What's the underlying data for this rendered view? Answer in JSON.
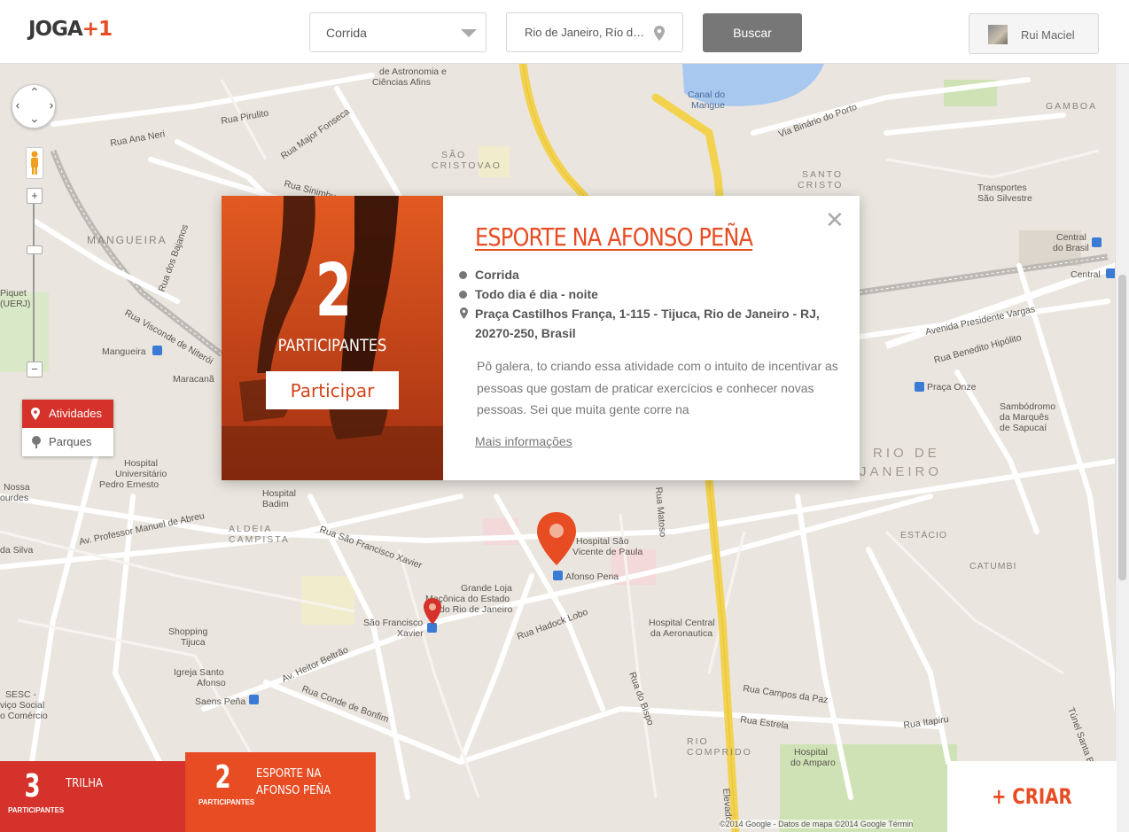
{
  "app": {
    "logo_text": "JOGA",
    "logo_plus": "+1"
  },
  "search": {
    "sport_value": "Corrida",
    "location_value": "Rio de Janeiro, Río de Janeiro, Brasil",
    "button_label": "Buscar"
  },
  "user": {
    "name": "Rui Maciel"
  },
  "layers": {
    "items": [
      {
        "label": "Atividades",
        "active": true
      },
      {
        "label": "Parques",
        "active": false
      }
    ]
  },
  "map_labels": [
    "de Astronomia e",
    "Ciências Afins",
    "Rua Ana Neri",
    "Rua Pirulito",
    "Rua Major Fonseca",
    "Rua Sinimbu",
    "SÃO",
    "CRISTOVAO",
    "MANGUEIRA",
    "Rua dos Bajanos",
    "Rua Visconde de Niterói",
    "Mangueira",
    "Maracanã",
    "Piquet",
    "(UERJ)",
    "Hospital",
    "Universitário",
    "Pedro Ernesto",
    "Nossa",
    "ourdes",
    "Hospital",
    "Badim",
    "ALDEIA",
    "CAMPISTA",
    "Av. Professor Manuel de Abreu",
    "da Silva",
    "Rua São Francisco Xavier",
    "Hospital São",
    "Vicente de Paula",
    "Afonso Pena",
    "Grande Loja",
    "Maçônica do Estado",
    "do Rio de Janeiro",
    "São Francisco",
    "Xavier",
    "Rua Hadock Lobo",
    "Hospital Central",
    "da Aeronautica",
    "Shopping",
    "Tijuca",
    "Igreja Santo",
    "Afonso",
    "Saens Peña",
    "SESC -",
    "viço Social",
    "o Comércio",
    "Rua Conde de Bonfim",
    "Av. Heitor Beltrão",
    "Rua Campos da Paz",
    "Rua Estrela",
    "Rua Itapiru",
    "RIO",
    "COMPRIDO",
    "Hospital",
    "do Amparo",
    "Canal do",
    "Mangue",
    "Via Binário do Porto",
    "GAMBOA",
    "SANTO",
    "CRISTO",
    "Transportes",
    "São Silvestre",
    "Central",
    "do Brasil",
    "Central",
    "Avenida Presidente Vargas",
    "Rua Benedito Hipólito",
    "Praça Onze",
    "Sambódromo",
    "da Marquês",
    "de Sapucaí",
    "RIO DE",
    "JANEIRO",
    "ESTÁCIO",
    "CATUMBI",
    "Túnel Santa Bárbara",
    "Rua do Bispo",
    "Elevado",
    "Rua Matoso"
  ],
  "activity": {
    "title": "ESPORTE NA AFONSO PEÑA",
    "participants": "2",
    "participants_label": "PARTICIPANTES",
    "join_label": "Participar",
    "close": "✕",
    "sport": "Corrida",
    "schedule": "Todo dia é dia - noite",
    "address": "Praça Castilhos França, 1-115 - Tijuca, Rio de Janeiro - RJ, 20270-250, Brasil",
    "description": "Pô galera, to criando essa atividade com o intuito de incentivar as  pessoas que gostam de praticar exercícios e conhecer novas pessoas. Sei que muita gente corre na",
    "more_link": "Mais informações"
  },
  "bottom_tabs": [
    {
      "count": "3",
      "label": "PARTICIPANTES",
      "name": "TRILHA"
    },
    {
      "count": "2",
      "label": "PARTICIPANTES",
      "name": "ESPORTE NA AFONSO PEÑA"
    }
  ],
  "create_button": "+ CRIAR",
  "attribution": "©2014 Google - Datos de mapa ©2014 Google    Términ",
  "colors": {
    "accent": "#e84c22",
    "accent_dark": "#d4322a",
    "search_button": "#777777",
    "map_bg": "#eae6df",
    "water": "#a9c8f0",
    "highway": "#f2d24e"
  }
}
